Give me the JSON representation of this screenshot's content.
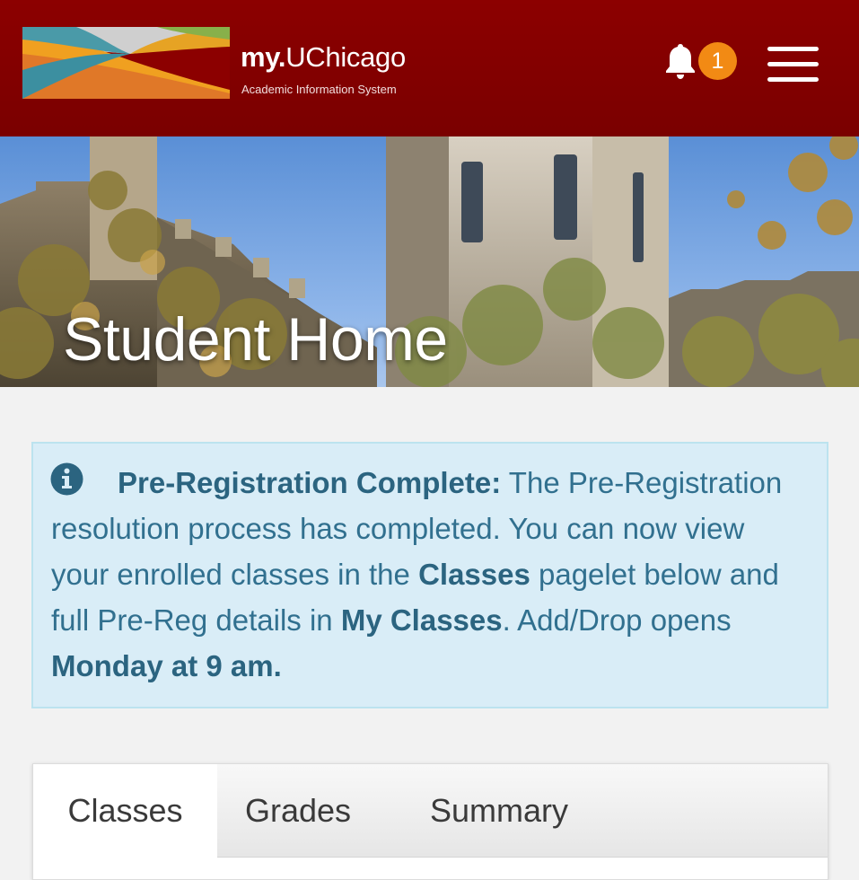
{
  "header": {
    "brand_bold": "my.",
    "brand_rest": "UChicago",
    "subtitle": "Academic Information System",
    "notification_count": "1",
    "colors": {
      "background": "#870000",
      "badge": "#f28a14"
    },
    "icons": {
      "notifications": "bell-icon",
      "menu": "hamburger-menu-icon"
    }
  },
  "hero": {
    "title": "Student Home"
  },
  "alert": {
    "heading": "Pre-Registration Complete:",
    "text_1": " The Pre-Registration resolution process has completed. You can now view your enrolled classes in the ",
    "link_classes": "Classes",
    "text_2": " pagelet below and full Pre-Reg details in ",
    "link_my_classes": "My Classes",
    "text_3": ". Add/Drop opens ",
    "emphasis": "Monday at 9 am.",
    "icon": "info-circle-icon",
    "colors": {
      "background": "#d9edf7",
      "text": "#31708f"
    }
  },
  "tabs": {
    "active": "Classes",
    "items": [
      {
        "label": "Classes"
      },
      {
        "label": "Grades"
      },
      {
        "label": "Summary"
      }
    ]
  }
}
